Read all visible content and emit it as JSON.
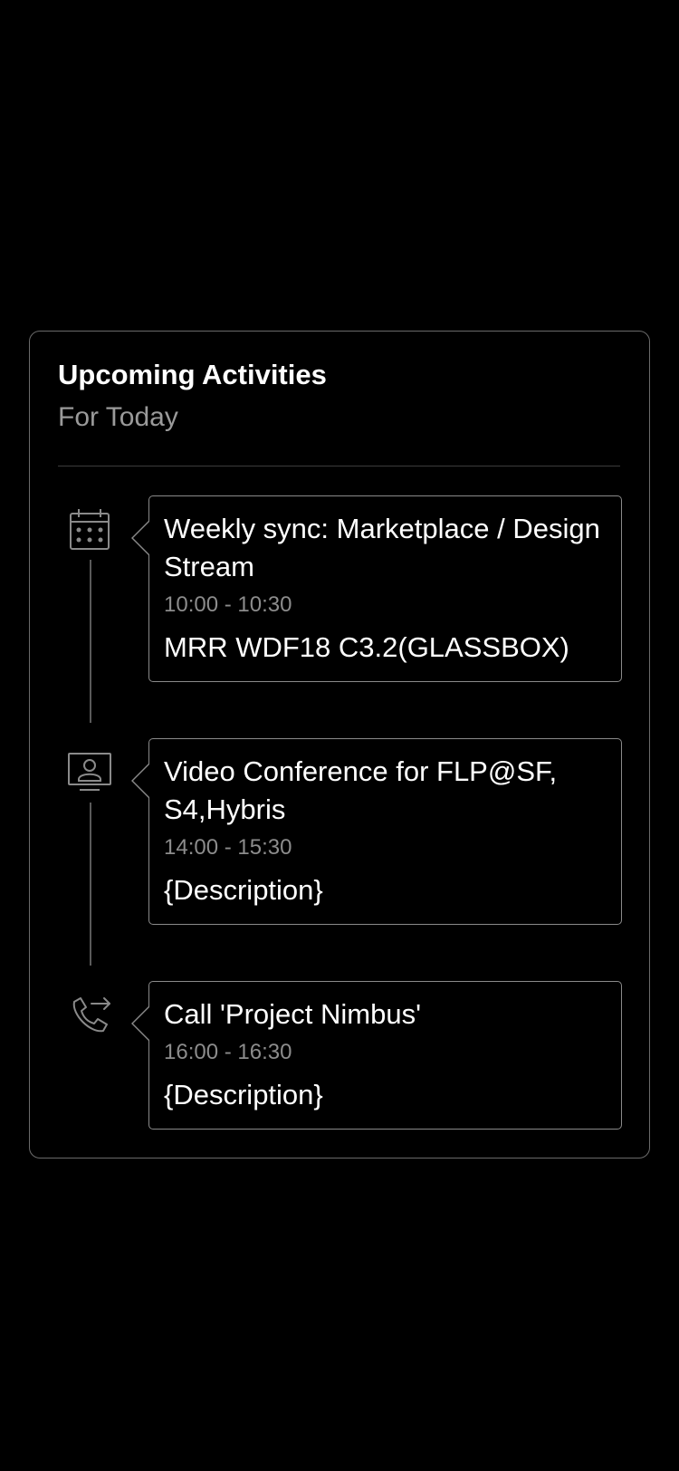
{
  "card": {
    "title": "Upcoming Activities",
    "subtitle": "For Today"
  },
  "activities": [
    {
      "icon": "calendar-icon",
      "title": "Weekly sync: Marketplace / Design Stream",
      "time": "10:00 - 10:30",
      "description": "MRR WDF18 C3.2(GLASSBOX)"
    },
    {
      "icon": "video-conference-icon",
      "title": "Video Conference for FLP@SF, S4,Hybris",
      "time": "14:00 - 15:30",
      "description": "{Description}"
    },
    {
      "icon": "phone-call-icon",
      "title": "Call 'Project Nimbus'",
      "time": "16:00 - 16:30",
      "description": "{Description}"
    }
  ],
  "colors": {
    "background": "#000000",
    "card_border": "#6a6a6a",
    "text_primary": "#ffffff",
    "text_secondary": "#9a9a9a",
    "icon": "#8a8a8a"
  }
}
